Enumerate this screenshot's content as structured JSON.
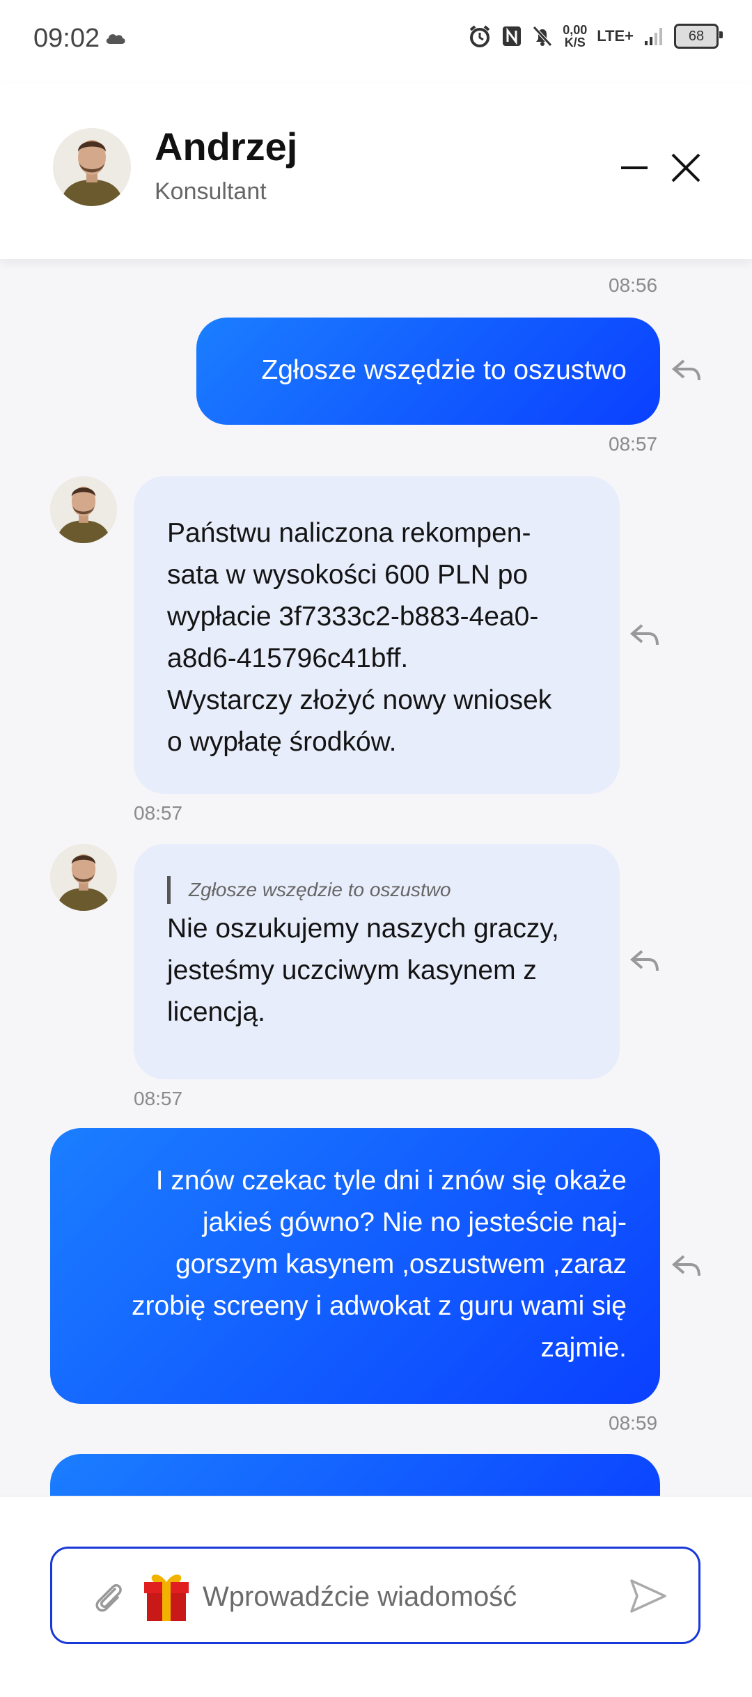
{
  "status_bar": {
    "time": "09:02",
    "speed_value": "0,00",
    "speed_unit": "K/S",
    "network": "LTE+",
    "battery": "68"
  },
  "header": {
    "agent_name": "Andrzej",
    "agent_role": "Konsultant"
  },
  "messages": [
    {
      "from": "user",
      "text": "",
      "time": "08:56"
    },
    {
      "from": "user",
      "text": "Zgłosze wszędzie to oszustwo",
      "time": "08:57"
    },
    {
      "from": "agent",
      "lines": [
        "Państwu naliczona rekompen-",
        "sata w wysokości 600 PLN po",
        "wypłacie 3f7333c2-b883-4ea0-",
        "a8d6-415796c41bff.",
        "Wystarczy złożyć nowy wniosek",
        "o wypłatę środków."
      ],
      "time": "08:57"
    },
    {
      "from": "agent",
      "quote": "Zgłosze wszędzie to oszustwo",
      "lines": [
        "Nie oszukujemy naszych graczy,",
        "jesteśmy uczciwym kasynem z",
        "licencją."
      ],
      "time": "08:57"
    },
    {
      "from": "user",
      "lines": [
        "I znów czekac tyle dni i znów się okaże",
        "jakieś gówno? Nie no jesteście naj-",
        "gorszym kasynem ,oszustwem ,zaraz",
        "zrobię screeny i adwokat z guru wami się",
        "zajmie."
      ],
      "time": "08:59"
    },
    {
      "from": "user",
      "text": "",
      "time": ""
    }
  ],
  "composer": {
    "placeholder": "Wprowadźcie wiadomość"
  },
  "colors": {
    "accent": "#1565ff",
    "incoming_bubble": "#e8edfb",
    "input_border": "#1838d8"
  },
  "icons": [
    "cloud-icon",
    "alarm-icon",
    "nfc-icon",
    "mute-icon",
    "signal-icon",
    "battery-icon",
    "minimize-icon",
    "close-icon",
    "reply-icon",
    "paperclip-icon",
    "gift-icon",
    "send-icon"
  ]
}
